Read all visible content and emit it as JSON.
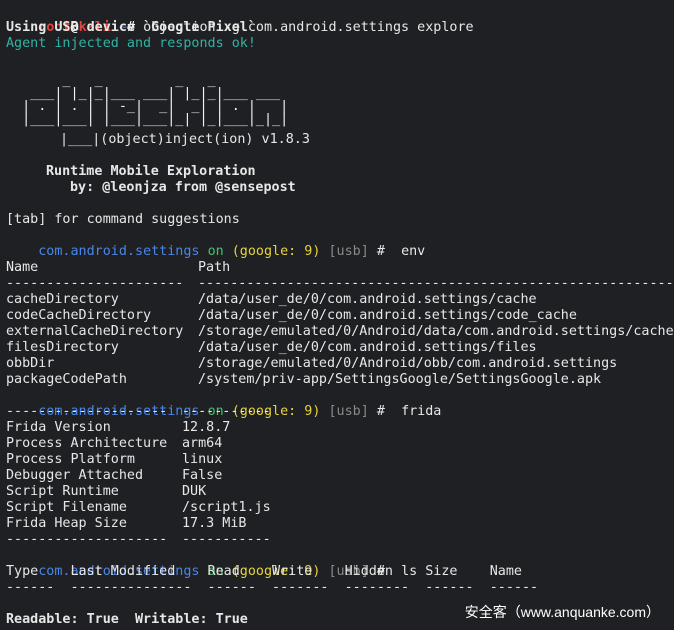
{
  "prompt": {
    "user": "root",
    "at": "@",
    "host": "kali",
    "path": ":~",
    "hash": "# ",
    "command": "objection -g com.android.settings explore"
  },
  "intro": {
    "usb_line": "Using USB device `Google Pixel`",
    "agent_line": "Agent injected and responds ok!"
  },
  "banner": {
    "version_line": "|___|(object)inject(ion) v1.8.3",
    "title": "Runtime Mobile Exploration",
    "byline": "by: @leonjza from @sensepost"
  },
  "hint": "[tab] for command suggestions",
  "obj_prompt": {
    "package": "com.android.settings",
    "on": "on",
    "device": "(google: 9)",
    "transport": "[usb]",
    "hash": "#"
  },
  "env_cmd": "env",
  "env_table": {
    "col_name": "Name",
    "col_path": "Path",
    "sep_name": "----------------------",
    "sep_path": "-------------------------------------------------------------------",
    "rows": [
      {
        "name": "cacheDirectory",
        "path": "/data/user_de/0/com.android.settings/cache"
      },
      {
        "name": "codeCacheDirectory",
        "path": "/data/user_de/0/com.android.settings/code_cache"
      },
      {
        "name": "externalCacheDirectory",
        "path": "/storage/emulated/0/Android/data/com.android.settings/cache"
      },
      {
        "name": "filesDirectory",
        "path": "/data/user_de/0/com.android.settings/files"
      },
      {
        "name": "obbDir",
        "path": "/storage/emulated/0/Android/obb/com.android.settings"
      },
      {
        "name": "packageCodePath",
        "path": "/system/priv-app/SettingsGoogle/SettingsGoogle.apk"
      }
    ]
  },
  "frida_cmd": "frida",
  "frida_table": {
    "sep_left": "--------------------",
    "sep_right": "-----------",
    "rows": [
      {
        "key": "Frida Version",
        "value": "12.8.7"
      },
      {
        "key": "Process Architecture",
        "value": "arm64"
      },
      {
        "key": "Process Platform",
        "value": "linux"
      },
      {
        "key": "Debugger Attached",
        "value": "False"
      },
      {
        "key": "Script Runtime",
        "value": "DUK"
      },
      {
        "key": "Script Filename",
        "value": "/script1.js"
      },
      {
        "key": "Frida Heap Size",
        "value": "17.3 MiB"
      }
    ]
  },
  "ls_cmd": "ls",
  "ls_table": {
    "header": "Type    Last Modified    Read    Write    Hidden    Size    Name",
    "separator": "------  ---------------  ------  -------  --------  ------  ------"
  },
  "status_line": "Readable: True  Writable: True",
  "watermark": "安全客（www.anquanke.com）",
  "colors": {
    "background": "#1f2023",
    "prompt_user": "#e0453f",
    "package": "#4a86e8",
    "agent_ok": "#2fb3a5",
    "on": "#49c06b",
    "device": "#e6d33c"
  }
}
